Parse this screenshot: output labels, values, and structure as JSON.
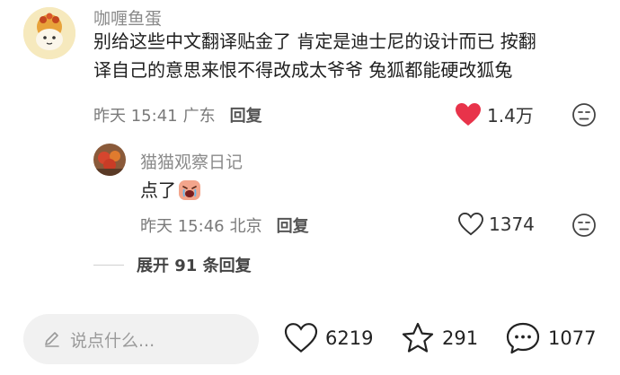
{
  "comment": {
    "username": "咖喱鱼蛋",
    "text_line1": "别给这些中文翻译贴金了 肯定是迪士尼的设计而已 按翻",
    "text_line2": "译自己的意思来恨不得改成太爷爷 兔狐都能硬改狐兔",
    "time": "昨天 15:41",
    "location": "广东",
    "reply_label": "回复",
    "likes": "1.4万",
    "liked": true
  },
  "reply": {
    "username": "猫猫观察日记",
    "text": "点了",
    "emoji": "crying-emoji",
    "time": "昨天 15:46",
    "location": "北京",
    "reply_label": "回复",
    "likes": "1374"
  },
  "expand_label": "展开 91 条回复",
  "bottom_bar": {
    "input_placeholder": "说点什么...",
    "like_count": "6219",
    "favorite_count": "291",
    "comment_count": "1077"
  },
  "colors": {
    "like_active": "#e8334a",
    "text_muted": "#8a8a8a"
  },
  "icons": [
    "heart-filled-icon",
    "heart-outline-icon",
    "dislike-face-icon",
    "pencil-icon",
    "star-icon",
    "chat-bubble-icon"
  ]
}
